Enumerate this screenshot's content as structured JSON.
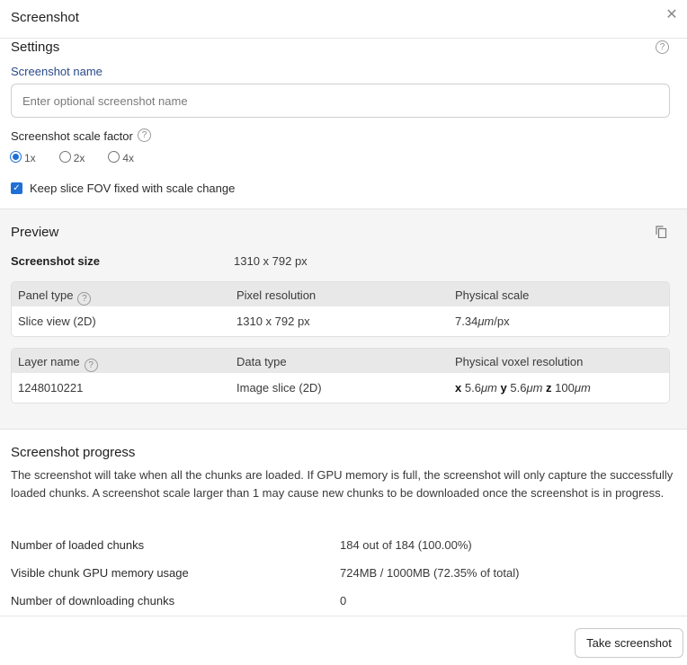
{
  "dialog": {
    "title": "Screenshot",
    "close_icon": "close-icon"
  },
  "settings": {
    "title": "Settings",
    "name_label": "Screenshot name",
    "name_value": "",
    "name_placeholder": "Enter optional screenshot name",
    "scale_label": "Screenshot scale factor",
    "scale_options": [
      "1x",
      "2x",
      "4x"
    ],
    "scale_selected": "1x",
    "keep_fov_label": "Keep slice FOV fixed with scale change",
    "keep_fov_checked": true,
    "help_glyph": "?"
  },
  "preview": {
    "title": "Preview",
    "size_label": "Screenshot size",
    "size_value": "1310 x 792 px",
    "panel_table": {
      "headers": [
        "Panel type",
        "Pixel resolution",
        "Physical scale"
      ],
      "row": [
        "Slice view (2D)",
        "1310 x 792 px",
        "7.34",
        "μm",
        "/px"
      ]
    },
    "layer_table": {
      "headers": [
        "Layer name",
        "Data type",
        "Physical voxel resolution"
      ],
      "row": {
        "name": "1248010221",
        "type": "Image slice (2D)",
        "x_label": "x",
        "x_val": "5.6",
        "y_label": "y",
        "y_val": "5.6",
        "z_label": "z",
        "z_val": "100",
        "unit": "μm"
      }
    }
  },
  "progress": {
    "title": "Screenshot progress",
    "description": "The screenshot will take when all the chunks are loaded. If GPU memory is full, the screenshot will only capture the successfully loaded chunks. A screenshot scale larger than 1 may cause new chunks to be downloaded once the screenshot is in progress.",
    "stats": [
      {
        "label": "Number of loaded chunks",
        "value": "184 out of 184 (100.00%)"
      },
      {
        "label": "Visible chunk GPU memory usage",
        "value": "724MB / 1000MB (72.35% of total)"
      },
      {
        "label": "Number of downloading chunks",
        "value": "0"
      }
    ]
  },
  "footer": {
    "take_button": "Take screenshot"
  },
  "colors": {
    "accent": "#1f6fd6",
    "label_blue": "#2a4a8a",
    "preview_bg": "#f5f5f5"
  }
}
